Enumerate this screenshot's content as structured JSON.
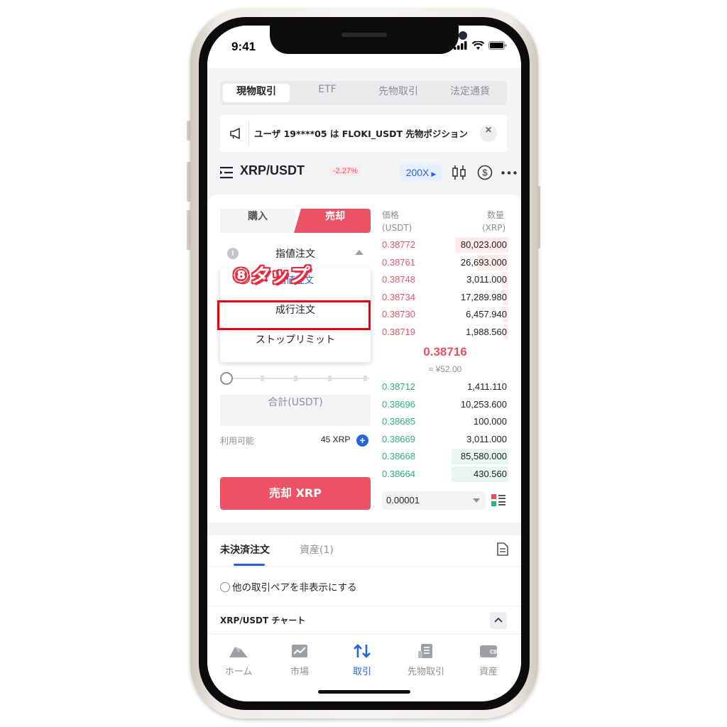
{
  "status_bar": {
    "time": "9:41"
  },
  "top_tabs": [
    {
      "label": "現物取引",
      "active": true
    },
    {
      "label": "ETF",
      "active": false
    },
    {
      "label": "先物取引",
      "active": false
    },
    {
      "label": "法定通貨",
      "active": false
    }
  ],
  "announcement": {
    "text": "ユーザ 19****05 は FLOKI_USDT 先物ポジション"
  },
  "pair": {
    "name": "XRP/USDT",
    "change": "-2.27%",
    "leverage": "200X"
  },
  "order_panel": {
    "buy_label": "購入",
    "sell_label": "売却",
    "order_type": "指値注文",
    "dropdown_options": [
      "指値注文",
      "成行注文",
      "ストップリミット"
    ],
    "total_placeholder": "合計(USDT)",
    "available_label": "利用可能",
    "available_value": "45 XRP",
    "sell_button": "売却 XRP",
    "slider_fraction": 0
  },
  "annotation": {
    "callout": "⑧タップ"
  },
  "order_book": {
    "price_header": "価格",
    "price_unit": "(USDT)",
    "qty_header": "数量",
    "qty_unit": "(XRP)",
    "asks": [
      {
        "price": "0.38772",
        "qty": "80,023.000",
        "depth": 0.42
      },
      {
        "price": "0.38761",
        "qty": "26,693.000",
        "depth": 0.25
      },
      {
        "price": "0.38748",
        "qty": "3,011.000",
        "depth": 0.05
      },
      {
        "price": "0.38734",
        "qty": "17,289.980",
        "depth": 0.05
      },
      {
        "price": "0.38730",
        "qty": "6,457.940",
        "depth": 0.05
      },
      {
        "price": "0.38719",
        "qty": "1,988.560",
        "depth": 0.04
      }
    ],
    "mid_price": "0.38716",
    "mid_fiat": "≈ ¥52.00",
    "bids": [
      {
        "price": "0.38712",
        "qty": "1,411.110",
        "depth": 0.0
      },
      {
        "price": "0.38696",
        "qty": "10,253.600",
        "depth": 0.0
      },
      {
        "price": "0.38685",
        "qty": "100.000",
        "depth": 0.0
      },
      {
        "price": "0.38669",
        "qty": "3,011.000",
        "depth": 0.0
      },
      {
        "price": "0.38668",
        "qty": "85,580.000",
        "depth": 0.45
      },
      {
        "price": "0.38664",
        "qty": "430.560",
        "depth": 0.45
      }
    ],
    "precision": "0.00001"
  },
  "orders_section": {
    "tab_open_orders": "未決済注文",
    "tab_assets": "資産(1)",
    "hide_pairs_label": "他の取引ペアを非表示にする",
    "chart_label": "XRP/USDT チャート"
  },
  "bottom_nav": [
    {
      "label": "ホーム",
      "icon": "home-icon",
      "active": false
    },
    {
      "label": "市場",
      "icon": "market-icon",
      "active": false
    },
    {
      "label": "取引",
      "icon": "trade-icon",
      "active": true
    },
    {
      "label": "先物取引",
      "icon": "futures-icon",
      "active": false
    },
    {
      "label": "資産",
      "icon": "wallet-icon",
      "active": false
    }
  ],
  "colors": {
    "sell": "#ec5266",
    "buy": "#2fb07e",
    "accent": "#2a62d8",
    "highlight": "#e50012"
  }
}
